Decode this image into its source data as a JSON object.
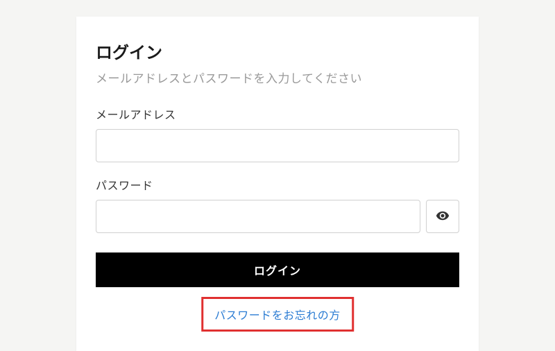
{
  "login": {
    "title": "ログイン",
    "subtitle": "メールアドレスとパスワードを入力してください",
    "email_label": "メールアドレス",
    "email_value": "",
    "password_label": "パスワード",
    "password_value": "",
    "submit_label": "ログイン",
    "forgot_password_label": "パスワードをお忘れの方"
  }
}
